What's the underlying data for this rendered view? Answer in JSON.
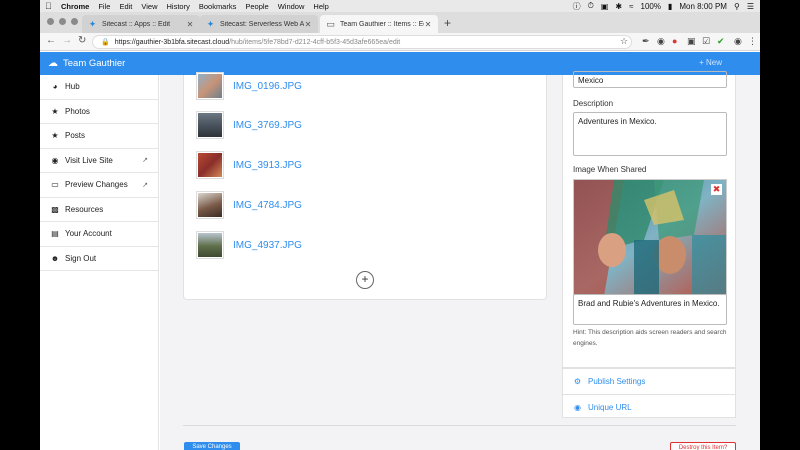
{
  "menubar": {
    "apple": "",
    "items": [
      "Chrome",
      "File",
      "Edit",
      "View",
      "History",
      "Bookmarks",
      "People",
      "Window",
      "Help"
    ],
    "battery": "100%",
    "clock": "Mon 8:00 PM"
  },
  "tabs": [
    {
      "title": "Sitecast :: Apps :: Edit",
      "icon": "sitecast-icon",
      "active": false
    },
    {
      "title": "Sitecast: Serverless Web Auto",
      "icon": "sitecast-icon",
      "active": false
    },
    {
      "title": "Team Gauthier :: Items :: Edit",
      "icon": "page-icon",
      "active": true
    }
  ],
  "address": {
    "host": "https://gauthier-3b1bfa.sitecast.cloud",
    "path": "/hub/items/5fe78bd7-d212-4cff-b5f3-45d3afe665ea/edit"
  },
  "header": {
    "brand": "Team Gauthier",
    "new_label": "+ New"
  },
  "sidebar": {
    "items": [
      {
        "label": "Hub",
        "icon": "dashboard-icon",
        "external": false
      },
      {
        "label": "Photos",
        "icon": "star-icon",
        "external": false
      },
      {
        "label": "Posts",
        "icon": "star-icon",
        "external": false
      },
      {
        "label": "Visit Live Site",
        "icon": "globe-icon",
        "external": true
      },
      {
        "label": "Preview Changes",
        "icon": "monitor-icon",
        "external": true
      },
      {
        "label": "Resources",
        "icon": "sitemap-icon",
        "external": false
      },
      {
        "label": "Your Account",
        "icon": "id-card-icon",
        "external": false
      },
      {
        "label": "Sign Out",
        "icon": "user-minus-icon",
        "external": false
      }
    ]
  },
  "images": [
    {
      "name": "IMG_0196.JPG"
    },
    {
      "name": "IMG_3769.JPG"
    },
    {
      "name": "IMG_3913.JPG"
    },
    {
      "name": "IMG_4784.JPG"
    },
    {
      "name": "IMG_4937.JPG"
    }
  ],
  "add_label": "+",
  "form": {
    "title_value": "Mexico",
    "description_label": "Description",
    "description_value": "Adventures in Mexico.",
    "share_label": "Image When Shared",
    "alt_value": "Brad and Rubie's Adventures in Mexico.",
    "hint": "Hint: This description aids screen readers and search engines."
  },
  "panel_links": {
    "publish": "Publish Settings",
    "unique_url": "Unique URL"
  },
  "footer": {
    "save_label": "Save Changes",
    "destroy_label": "Destroy this Item?"
  }
}
